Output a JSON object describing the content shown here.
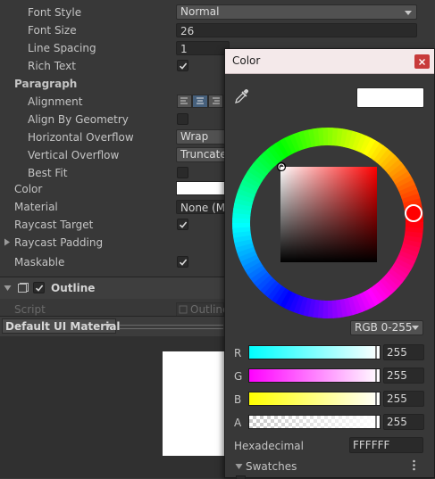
{
  "inspector": {
    "rows": [
      {
        "id": "font_style",
        "label": "Font Style",
        "value": "Normal"
      },
      {
        "id": "font_size",
        "label": "Font Size",
        "value": "26"
      },
      {
        "id": "line_spacing",
        "label": "Line Spacing",
        "value": "1"
      },
      {
        "id": "rich_text",
        "label": "Rich Text",
        "checked": true
      },
      {
        "id": "alignment",
        "label": "Alignment"
      },
      {
        "id": "align_geometry",
        "label": "Align By Geometry",
        "checked": false
      },
      {
        "id": "h_overflow",
        "label": "Horizontal Overflow",
        "value": "Wrap"
      },
      {
        "id": "v_overflow",
        "label": "Vertical Overflow",
        "value": "Truncate"
      },
      {
        "id": "best_fit",
        "label": "Best Fit",
        "checked": false
      },
      {
        "id": "color",
        "label": "Color",
        "color": "#ffffff"
      },
      {
        "id": "material",
        "label": "Material",
        "value": "None (Ma"
      },
      {
        "id": "raycast_target",
        "label": "Raycast Target",
        "checked": true
      },
      {
        "id": "raycast_padding",
        "label": "Raycast Padding"
      },
      {
        "id": "maskable",
        "label": "Maskable",
        "checked": true
      }
    ],
    "paragraph_header": "Paragraph",
    "outline_component": {
      "title": "Outline",
      "enabled": true,
      "script_label": "Script",
      "script_value": "Outline"
    },
    "material_bar": {
      "label": "Default UI Material"
    }
  },
  "color_picker": {
    "title": "Color",
    "current_color": "#ffffff",
    "mode": "RGB 0-255",
    "channels": [
      {
        "name": "R",
        "value": "255"
      },
      {
        "name": "G",
        "value": "255"
      },
      {
        "name": "B",
        "value": "255"
      },
      {
        "name": "A",
        "value": "255"
      }
    ],
    "hex_label": "Hexadecimal",
    "hex_value": "FFFFFF",
    "swatches_label": "Swatches"
  }
}
